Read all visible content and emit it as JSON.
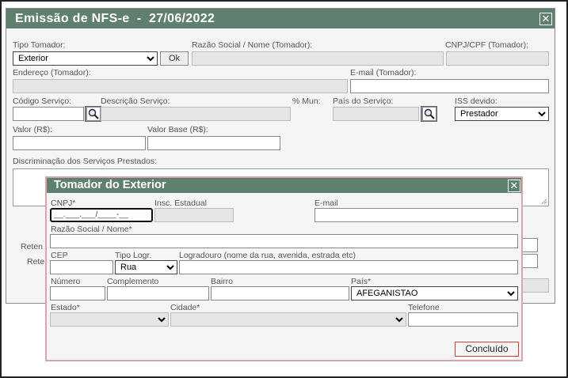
{
  "main": {
    "title": "Emissão de NFS-e  -  27/06/2022",
    "close_glyph": "✕",
    "labels": {
      "tipo_tomador": "Tipo Tomador:",
      "razao_social": "Razão Social / Nome (Tomador):",
      "cnpj_cpf": "CNPJ/CPF (Tomador):",
      "endereco": "Endereço (Tomador):",
      "email": "E-mail (Tomador):",
      "codigo_servico": "Código Serviço:",
      "descricao_servico": "Descrição Serviço:",
      "perc_mun": "% Mun:",
      "pais_servico": "País do Serviço:",
      "iss_devido": "ISS devido:",
      "valor": "Valor (R$):",
      "valor_base": "Valor Base (R$):",
      "discriminacao": "Discriminação dos Serviços Prestados:",
      "retencao_1": "Reten",
      "retencao_2": "Rete"
    },
    "tipo_tomador_value": "Exterior",
    "ok_label": "Ok",
    "iss_devido_value": "Prestador"
  },
  "tomador_exterior": {
    "title": "Tomador do Exterior",
    "close_glyph": "✕",
    "labels": {
      "cnpj": "CNPJ*",
      "insc_estadual": "Insc. Estadual",
      "email": "E-mail",
      "razao_social": "Razão Social / Nome*",
      "cep": "CEP",
      "tipo_logr": "Tipo Logr.",
      "logradouro": "Logradouro (nome da rua, avenida, estrada etc)",
      "numero": "Número",
      "complemento": "Complemento",
      "bairro": "Bairro",
      "pais": "País*",
      "estado": "Estado*",
      "cidade": "Cidade*",
      "telefone": "Telefone"
    },
    "cnpj_mask": "__.___.___/____-__",
    "tipo_logr_value": "Rua",
    "pais_value": "AFEGANISTAO",
    "concluido_label": "Concluído"
  }
}
